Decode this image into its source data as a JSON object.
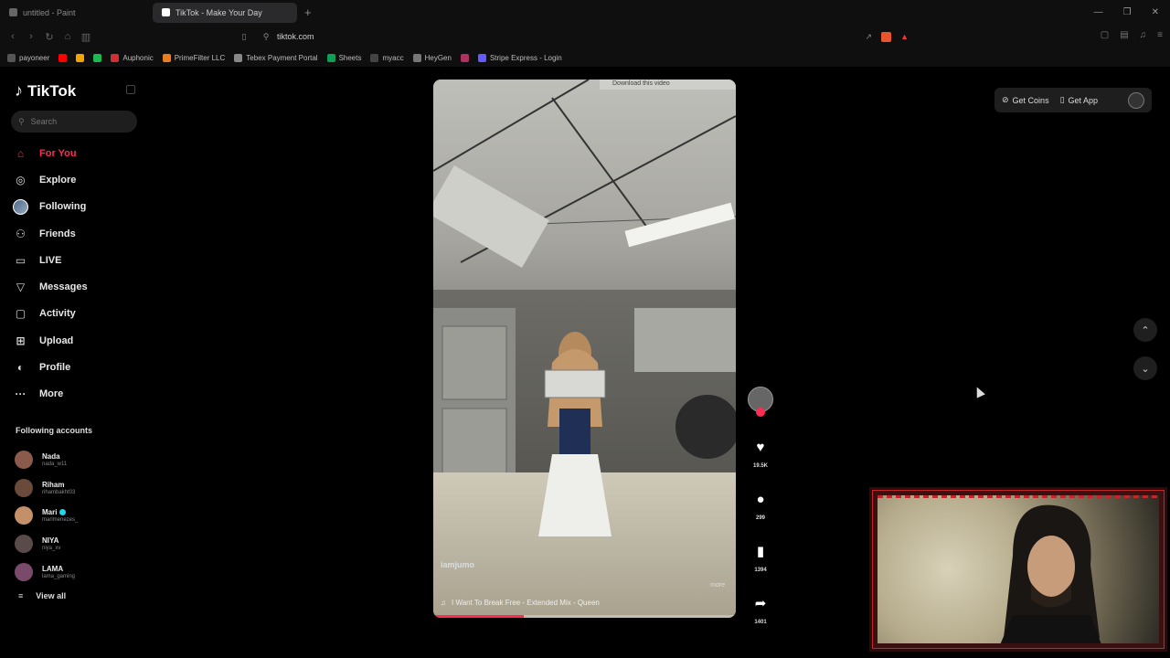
{
  "browser": {
    "tabs": [
      {
        "label": "untitled - Paint",
        "active": false
      },
      {
        "label": "TikTok - Make Your Day",
        "active": true
      }
    ],
    "url": "tiktok.com",
    "bookmarks": [
      {
        "label": "payoneer",
        "color": "#555555"
      },
      {
        "label": "",
        "color": "#ff0000"
      },
      {
        "label": "",
        "color": "#f4a300"
      },
      {
        "label": "",
        "color": "#1db954"
      },
      {
        "label": "Auphonic",
        "color": "#d32f2f"
      },
      {
        "label": "PrimeFilter LLC",
        "color": "#e67e22"
      },
      {
        "label": "Tebex Payment Portal",
        "color": "#888888"
      },
      {
        "label": "Sheets",
        "color": "#0f9d58"
      },
      {
        "label": "myacc",
        "color": "#444444"
      },
      {
        "label": "HeyGen",
        "color": "#777777"
      },
      {
        "label": "",
        "color": "#b03060"
      },
      {
        "label": "Stripe Express - Login",
        "color": "#635bff"
      }
    ]
  },
  "sidebar": {
    "brand": "TikTok",
    "search_placeholder": "Search",
    "nav": [
      {
        "label": "For You",
        "icon": "home-icon",
        "glyph": "⌂"
      },
      {
        "label": "Explore",
        "icon": "compass-icon",
        "glyph": "◎"
      },
      {
        "label": "Following",
        "icon": "following-avatar-icon",
        "glyph": ""
      },
      {
        "label": "Friends",
        "icon": "friends-icon",
        "glyph": "⚇"
      },
      {
        "label": "LIVE",
        "icon": "live-icon",
        "glyph": "▭"
      },
      {
        "label": "Messages",
        "icon": "messages-icon",
        "glyph": "▽"
      },
      {
        "label": "Activity",
        "icon": "activity-icon",
        "glyph": "▢"
      },
      {
        "label": "Upload",
        "icon": "upload-icon",
        "glyph": "⊞"
      },
      {
        "label": "Profile",
        "icon": "profile-icon",
        "glyph": "◐"
      },
      {
        "label": "More",
        "icon": "more-icon",
        "glyph": "···"
      }
    ],
    "following_title": "Following accounts",
    "accounts": [
      {
        "name": "Nada",
        "handle": "nada_w11",
        "verified": false
      },
      {
        "name": "Riham",
        "handle": "rihambakht03",
        "verified": false
      },
      {
        "name": "Mari",
        "handle": "marimenezes_",
        "verified": true
      },
      {
        "name": "NIYA",
        "handle": "niya_xv",
        "verified": false
      },
      {
        "name": "LAMA",
        "handle": "lama_gaming",
        "verified": false
      }
    ],
    "view_all": "View all"
  },
  "video": {
    "download_overlay": "Download this video",
    "username": "iamjumo",
    "more": "more",
    "music": "I Want To Break Free - Extended Mix - Queen",
    "progress_percent": 30,
    "likes": "19.5K",
    "comments": "299",
    "saves": "1394",
    "shares": "1401"
  },
  "topbar": {
    "get_coins": "Get Coins",
    "get_app": "Get App"
  },
  "colors": {
    "accent": "#fe2c55",
    "verified": "#20d5ec"
  }
}
